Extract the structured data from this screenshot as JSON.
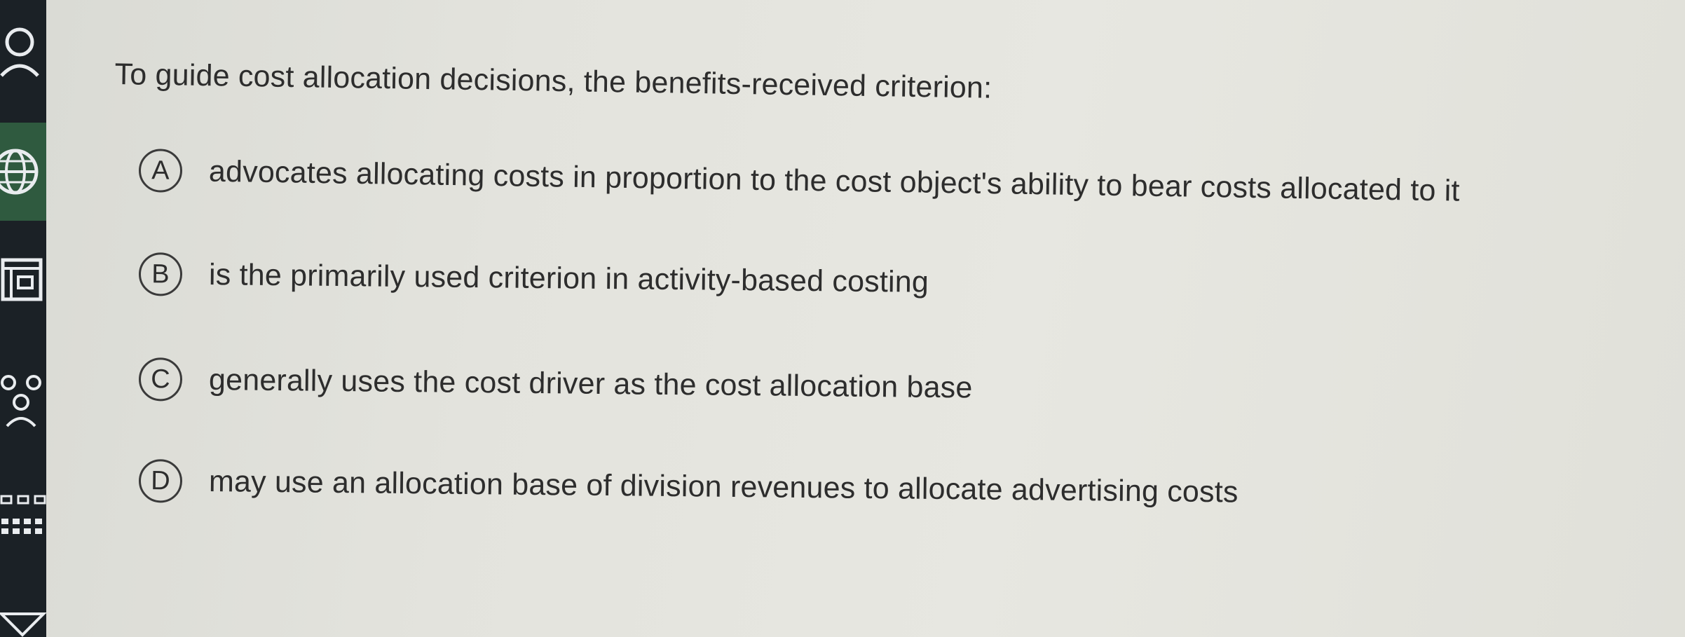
{
  "question": {
    "text": "To guide cost allocation decisions, the benefits-received criterion:"
  },
  "options": [
    {
      "letter": "A",
      "text": "advocates allocating costs in proportion to the cost object's ability to bear costs allocated to it"
    },
    {
      "letter": "B",
      "text": "is the primarily used criterion in activity-based costing"
    },
    {
      "letter": "C",
      "text": "generally uses the cost driver as the cost allocation base"
    },
    {
      "letter": "D",
      "text": "may use an allocation base of division revenues to allocate advertising costs"
    }
  ],
  "sidebar": {
    "icons": [
      "user-icon",
      "globe-icon",
      "layout-icon",
      "people-icon",
      "grid-icon",
      "expand-icon"
    ]
  },
  "colors": {
    "sidebar_bg": "#1b2126",
    "sidebar_active": "#2f5a3f",
    "text": "#2d2d2d",
    "page_bg": "#e3e3dd"
  }
}
